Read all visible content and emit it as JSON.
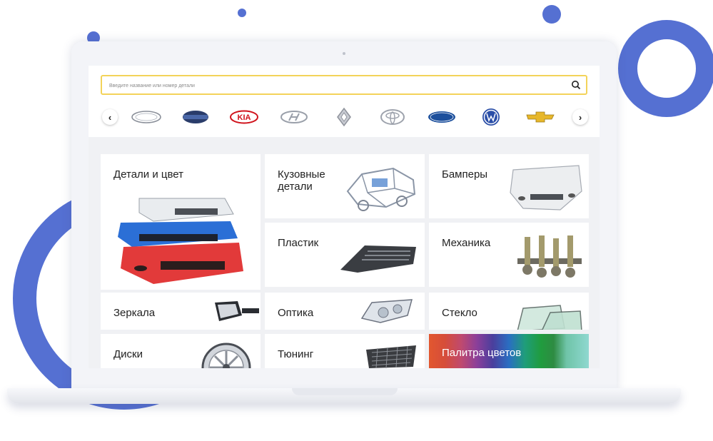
{
  "search": {
    "placeholder": "Введите название или номер детали",
    "icon": "search-icon"
  },
  "carousel": {
    "prev_icon": "chevron-left-icon",
    "next_icon": "chevron-right-icon",
    "brands": [
      "Ford",
      "Datsun",
      "KIA",
      "Hyundai",
      "Renault",
      "Toyota",
      "Ford",
      "Volkswagen",
      "Chevrolet"
    ]
  },
  "tiles": [
    {
      "label": "Детали и цвет"
    },
    {
      "label": "Кузовные детали"
    },
    {
      "label": "Бамперы"
    },
    {
      "label": "Пластик"
    },
    {
      "label": "Механика"
    },
    {
      "label": "Зеркала"
    },
    {
      "label": "Оптика"
    },
    {
      "label": "Стекло"
    },
    {
      "label": "Диски"
    },
    {
      "label": "Тюнинг"
    },
    {
      "label": "Палитра цветов"
    }
  ],
  "colors": {
    "accent": "#5570d2",
    "search_border": "#f3d35a",
    "kia_red": "#d0121b",
    "ford_blue": "#1c4f9c"
  }
}
